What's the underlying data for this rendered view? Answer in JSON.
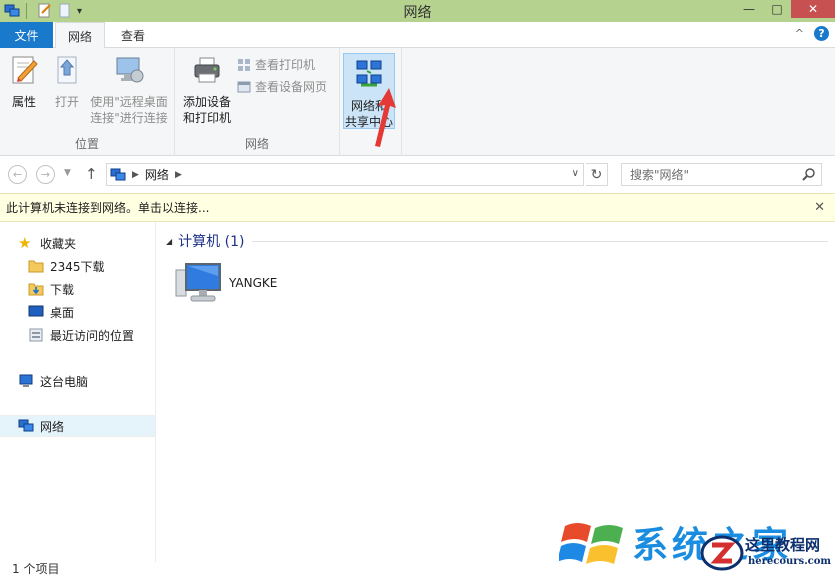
{
  "window": {
    "title": "网络",
    "controls": {
      "minimize": "—",
      "maximize": "□",
      "close": "✕"
    },
    "qat_dropdown": "▾"
  },
  "tabs": {
    "file": "文件",
    "network": "网络",
    "view": "查看",
    "collapse": "^",
    "help": "?"
  },
  "ribbon": {
    "location_group": {
      "label": "位置",
      "properties": "属性",
      "open": "打开",
      "remote_desktop": [
        "使用\"远程桌面",
        "连接\"进行连接"
      ]
    },
    "network_group": {
      "label": "网络",
      "add_device": [
        "添加设备",
        "和打印机"
      ],
      "view_printers": "查看打印机",
      "view_device_webpage": "查看设备网页"
    },
    "system_group": {
      "network_sharing_center": [
        "网络和",
        "共享中心"
      ]
    }
  },
  "address_bar": {
    "path": [
      "网络"
    ],
    "search_placeholder": "搜索\"网络\""
  },
  "infobar": {
    "message": "此计算机未连接到网络。单击以连接...",
    "close": "✕"
  },
  "nav_pane": {
    "favorites": "收藏夹",
    "fav_items": [
      "2345下载",
      "下载",
      "桌面",
      "最近访问的位置"
    ],
    "this_pc": "这台电脑",
    "network": "网络"
  },
  "content": {
    "group_header": "计算机 (1)",
    "items": [
      "YANGKE"
    ]
  },
  "status": {
    "item_count": "1 个项目"
  },
  "watermark": {
    "brand": "系统之家",
    "site_title": "这里教程网",
    "site_url": "herecours.com"
  },
  "colors": {
    "titlebar": "#b6d28f",
    "file_tab": "#1979ca",
    "infobar": "#ffffe1",
    "selection": "#e5f3fb",
    "annotation_arrow": "#e53935"
  }
}
